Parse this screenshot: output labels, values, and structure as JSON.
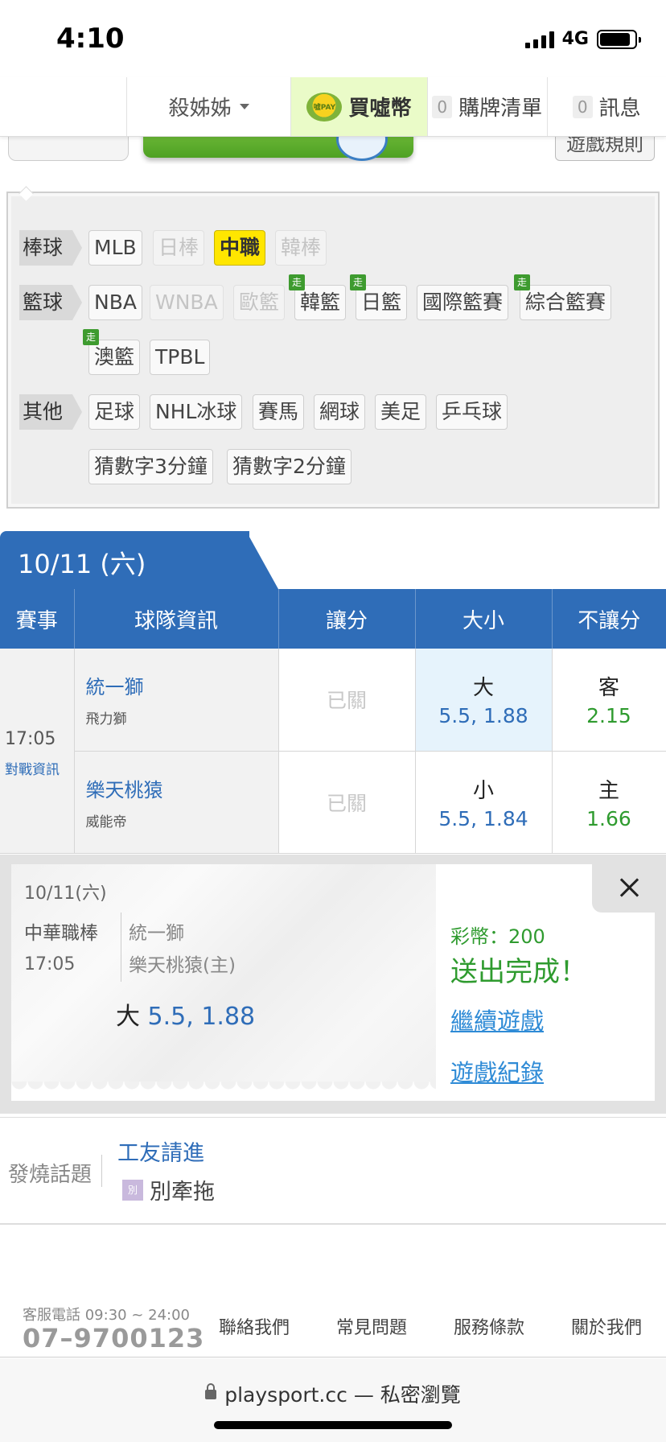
{
  "status_bar": {
    "time": "4:10",
    "network": "4G"
  },
  "top_nav": {
    "username": "殺姊姊",
    "buy_coins": "買噓幣",
    "coin_icon_text": "噓PAY",
    "cart_label": "購牌清單",
    "cart_count": "0",
    "messages_label": "訊息",
    "messages_count": "0"
  },
  "game_rules_label": "遊戲規則",
  "categories": {
    "baseball": {
      "label": "棒球",
      "items": [
        {
          "name": "MLB",
          "state": "normal"
        },
        {
          "name": "日棒",
          "state": "disabled"
        },
        {
          "name": "中職",
          "state": "active"
        },
        {
          "name": "韓棒",
          "state": "disabled"
        }
      ]
    },
    "basketball": {
      "label": "籃球",
      "walk_badge": "走",
      "items": [
        {
          "name": "NBA",
          "state": "normal"
        },
        {
          "name": "WNBA",
          "state": "disabled"
        },
        {
          "name": "歐籃",
          "state": "disabled"
        },
        {
          "name": "韓籃",
          "state": "normal"
        },
        {
          "name": "日籃",
          "state": "normal"
        },
        {
          "name": "國際籃賽",
          "state": "normal"
        },
        {
          "name": "綜合籃賽",
          "state": "normal"
        },
        {
          "name": "澳籃",
          "state": "normal"
        },
        {
          "name": "TPBL",
          "state": "normal"
        }
      ]
    },
    "other": {
      "label": "其他",
      "items": [
        {
          "name": "足球",
          "state": "normal"
        },
        {
          "name": "NHL冰球",
          "state": "normal"
        },
        {
          "name": "賽馬",
          "state": "normal"
        },
        {
          "name": "網球",
          "state": "normal"
        },
        {
          "name": "美足",
          "state": "normal"
        },
        {
          "name": "乒乓球",
          "state": "normal"
        },
        {
          "name": "猜數字3分鐘",
          "state": "normal"
        },
        {
          "name": "猜數字2分鐘",
          "state": "normal"
        }
      ]
    }
  },
  "date_header": "10/11 (六)",
  "table": {
    "headers": [
      "賽事",
      "球隊資訊",
      "讓分",
      "大小",
      "不讓分"
    ],
    "game": {
      "time": "17:05",
      "matchup_link": "對戰資訊",
      "away": {
        "team": "統一獅",
        "pitcher": "飛力獅",
        "spread": "已關",
        "ou_label": "大",
        "ou_value": "5.5, 1.88",
        "ml_label": "客",
        "ml_value": "2.15"
      },
      "home": {
        "team": "樂天桃猿",
        "pitcher": "威能帝",
        "spread": "已關",
        "ou_label": "小",
        "ou_value": "5.5, 1.84",
        "ml_label": "主",
        "ml_value": "1.66"
      }
    }
  },
  "confirmation": {
    "date": "10/11(六)",
    "league": "中華職棒",
    "time": "17:05",
    "team1": "統一獅",
    "team2": "樂天桃猿(主)",
    "bet_label": "大",
    "bet_value": "5.5, 1.88",
    "coins": "彩幣：200",
    "done": "送出完成！",
    "continue": "繼續遊戲",
    "record": "遊戲紀錄"
  },
  "hot_topics": {
    "label": "發燒話題",
    "topic1": "工友請進",
    "tag": "別",
    "topic2": "別牽拖"
  },
  "footer": {
    "service_hours": "客服電話 09:30 ~ 24:00",
    "phone": "07–9700123",
    "links": [
      "聯絡我們",
      "常見問題",
      "服務條款",
      "關於我們"
    ]
  },
  "browser": {
    "url": "playsport.cc — 私密瀏覽"
  }
}
